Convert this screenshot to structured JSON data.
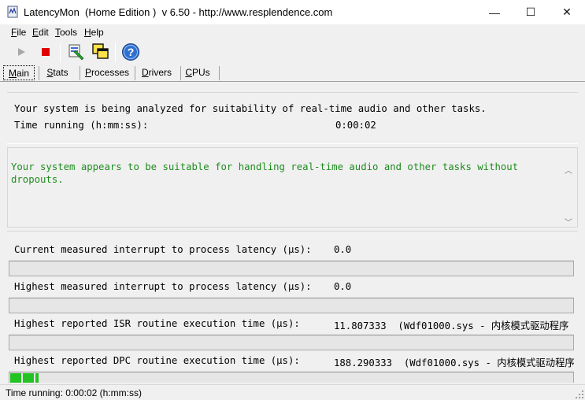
{
  "window": {
    "title": "LatencyMon  (Home Edition )  v 6.50 - http://www.resplendence.com",
    "minimize": "—",
    "maximize": "☐",
    "close": "✕"
  },
  "menu": [
    {
      "accel": "F",
      "rest": "ile"
    },
    {
      "accel": "E",
      "rest": "dit"
    },
    {
      "accel": "T",
      "rest": "ools"
    },
    {
      "accel": "H",
      "rest": "elp"
    }
  ],
  "toolbar": {
    "icons": [
      "play-icon",
      "stop-icon",
      "process-icon",
      "windows-icon",
      "help-icon"
    ]
  },
  "tabs": [
    {
      "accel": "M",
      "rest": "ain"
    },
    {
      "accel": "S",
      "rest": "tats"
    },
    {
      "accel": "P",
      "rest": "rocesses"
    },
    {
      "accel": "D",
      "rest": "rivers"
    },
    {
      "accel": "C",
      "rest": "PUs"
    }
  ],
  "analysis": {
    "message": "Your system is being analyzed for suitability of real-time audio and other tasks.",
    "time_label": "Time running (h:mm:ss):",
    "time_value": "0:00:02"
  },
  "verdict": {
    "line1": "Your system appears to be suitable for handling real-time audio and other tasks without",
    "line2": "dropouts.",
    "color": "#1e8c1e"
  },
  "metrics": [
    {
      "label": "Current measured interrupt to process latency (µs):",
      "value": "0.0",
      "fill": 0.0
    },
    {
      "label": "Highest measured interrupt to process latency (µs):",
      "value": "0.0",
      "fill": 0.0
    },
    {
      "label": "Highest reported ISR routine execution time (µs):",
      "value": "11.807333  (Wdf01000.sys - 内核模式驱动程序",
      "fill": 0.0
    },
    {
      "label": "Highest reported DPC routine execution time (µs):",
      "value": "188.290333  (Wdf01000.sys - 内核模式驱动程序",
      "fill": 0.05
    }
  ],
  "status": {
    "text": "Time running: 0:00:02  (h:mm:ss)"
  }
}
